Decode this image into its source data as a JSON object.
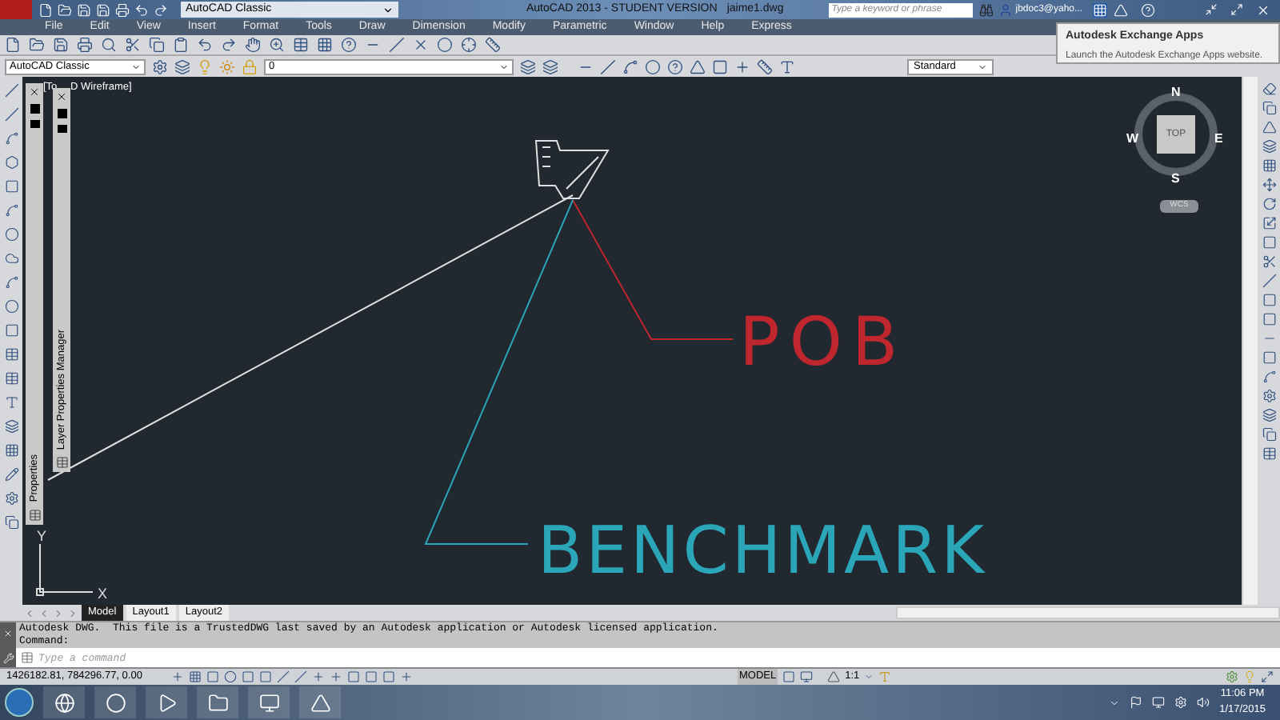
{
  "title_bar": {
    "workspace": "AutoCAD Classic",
    "title": "AutoCAD 2013 - STUDENT VERSION",
    "file": "jaime1.dwg",
    "search": {
      "placeholder": "Type a keyword or phrase"
    },
    "user": "jbdoc3@yaho..."
  },
  "menu": [
    "File",
    "Edit",
    "View",
    "Insert",
    "Format",
    "Tools",
    "Draw",
    "Dimension",
    "Modify",
    "Parametric",
    "Window",
    "Help",
    "Express"
  ],
  "toolbar": {
    "workspace": "AutoCAD Classic",
    "layer": "0",
    "text_style": "Standard"
  },
  "tooltip": {
    "title": "Autodesk Exchange Apps",
    "text": "Launch the Autodesk Exchange Apps website."
  },
  "viewport": {
    "label_start": "[To",
    "label_end": "D Wireframe]"
  },
  "palettes": [
    {
      "title": "Properties"
    },
    {
      "title": "Layer Properties Manager"
    }
  ],
  "drawing": {
    "labels": [
      {
        "text": "POB",
        "color": "#c0262d"
      },
      {
        "text": "BENCHMARK",
        "color": "#2aa6b8"
      }
    ]
  },
  "viewcube": {
    "face": "TOP",
    "north": "N",
    "south": "S",
    "east": "E",
    "west": "W",
    "ucs": "WCS"
  },
  "ucs_icon": {
    "x": "X",
    "y": "Y"
  },
  "layout_tabs": [
    {
      "label": "Model",
      "selected": true
    },
    {
      "label": "Layout1",
      "selected": false
    },
    {
      "label": "Layout2",
      "selected": false
    }
  ],
  "command_history": [
    "Autodesk DWG.  This file is a TrustedDWG last saved by an Autodesk application or Autodesk licensed application.",
    "Command:"
  ],
  "command_line": {
    "placeholder": "Type a command"
  },
  "status_bar": {
    "coordinates": "1426182.81, 784296.77, 0.00",
    "space": "MODEL",
    "scale": "1:1"
  },
  "taskbar": {
    "time": "11:06 PM",
    "date": "1/17/2015"
  }
}
